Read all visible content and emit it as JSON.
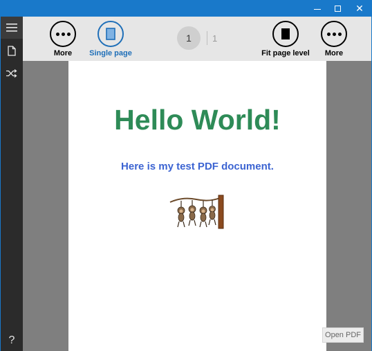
{
  "toolbar": {
    "more_left_label": "More",
    "single_page_label": "Single page",
    "fit_page_label": "Fit page level",
    "more_right_label": "More"
  },
  "pager": {
    "current": "1",
    "total": "1"
  },
  "sidebar": {
    "help_glyph": "?"
  },
  "document": {
    "title": "Hello World!",
    "subtitle": "Here is my test PDF document.",
    "image_icon": "hanging-monkeys-illustration"
  },
  "actions": {
    "open_pdf_label": "Open PDF"
  },
  "colors": {
    "titlebar": "#1979ca",
    "accent": "#1f6fb8",
    "title_text": "#2e8b57",
    "subtitle_text": "#3c64d2"
  }
}
